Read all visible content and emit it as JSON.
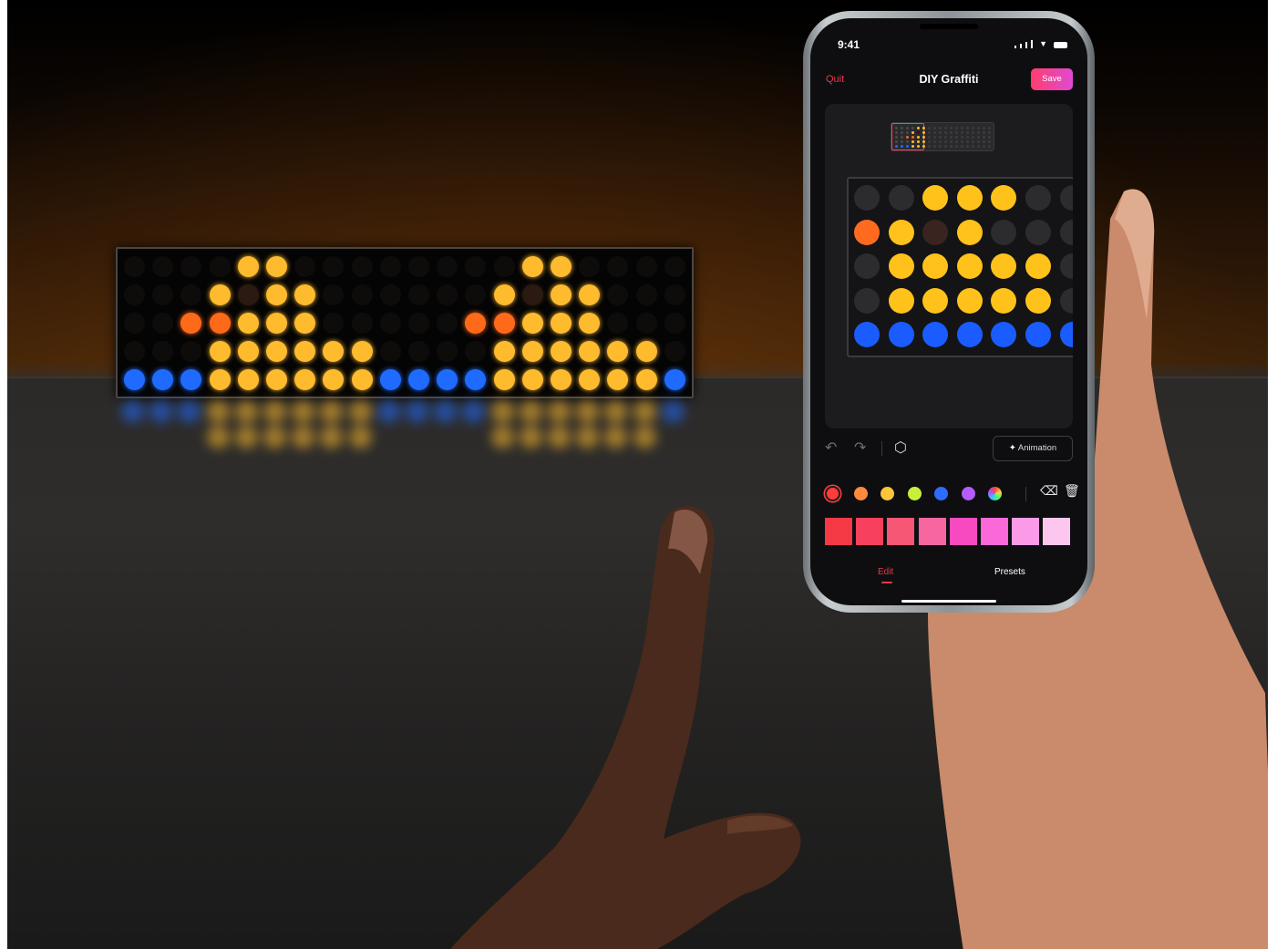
{
  "status_bar": {
    "time": "9:41"
  },
  "nav": {
    "quit_label": "Quit",
    "title": "DIY Graffiti",
    "save_label": "Save"
  },
  "toolbar": {
    "animation_label": "Animation",
    "icons": [
      "undo-icon",
      "redo-icon",
      "cube-icon",
      "sparkle-icon"
    ]
  },
  "palette": {
    "colors": [
      "#ff3b3b",
      "#ff8a3d",
      "#ffc43a",
      "#c8ef3a",
      "#2d6cff",
      "#b55cff",
      "rainbow"
    ],
    "shades": [
      "#f53a45",
      "#f6405d",
      "#f65775",
      "#f866a0",
      "#f84ac0",
      "#fb68d8",
      "#fb9ae6",
      "#fcc6ee"
    ],
    "tool_icons": [
      "eraser-icon",
      "trash-icon"
    ]
  },
  "tabs": {
    "edit_label": "Edit",
    "presets_label": "Presets",
    "active": "Edit"
  },
  "led_display": {
    "colors": {
      "yellow": "#ffbb2e",
      "orange": "#ff6a1a",
      "blue": "#1f6bff",
      "dark": "#2a1a12"
    }
  },
  "grid_editor": {
    "colors": {
      "yellow": "#ffc21a",
      "orange": "#ff6a1f",
      "blue": "#1a5cff",
      "off": "#2c2c2e",
      "brown": "#3a2420"
    }
  }
}
